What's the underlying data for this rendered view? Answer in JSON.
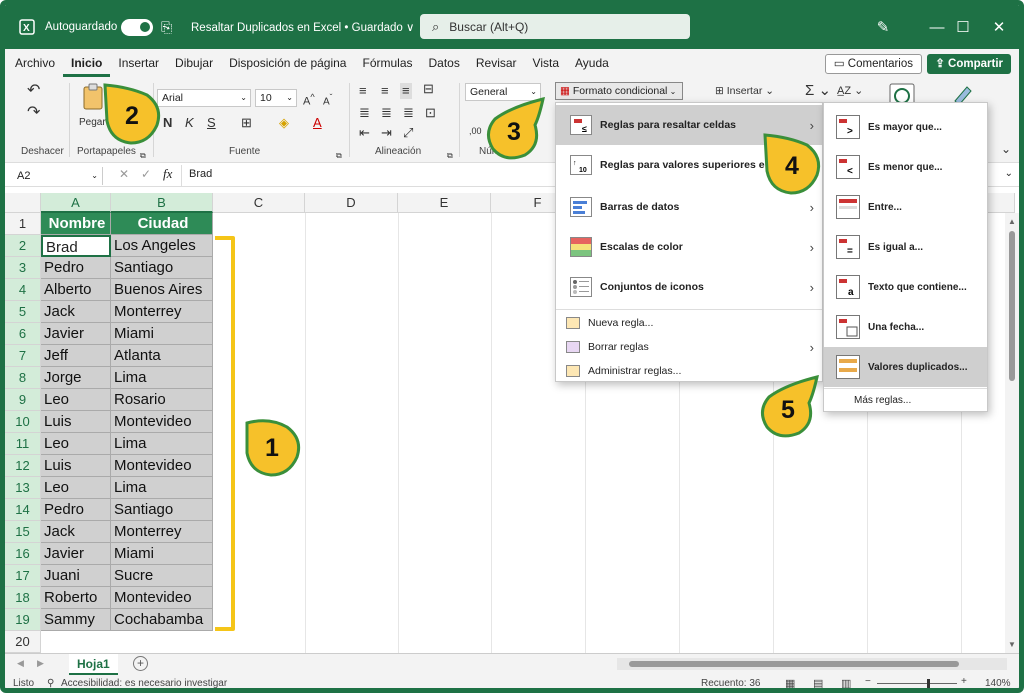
{
  "titlebar": {
    "autosave_label": "Autoguardado",
    "doc_title": "Resaltar Duplicados en Excel • Guardado ∨",
    "search_placeholder": "Buscar (Alt+Q)"
  },
  "menu": {
    "items": [
      "Archivo",
      "Inicio",
      "Insertar",
      "Dibujar",
      "Disposición de página",
      "Fórmulas",
      "Datos",
      "Revisar",
      "Vista",
      "Ayuda"
    ],
    "active": "Inicio",
    "comments_label": "Comentarios",
    "share_label": "Compartir"
  },
  "ribbon": {
    "undo_label": "Deshacer",
    "paste_label": "Pegar",
    "clipboard_label": "Portapapeles",
    "font_name": "Arial",
    "font_size": "10",
    "font_group_label": "Fuente",
    "bold": "N",
    "italic": "K",
    "underline": "S",
    "align_label": "Alineación",
    "number_format": "General",
    "number_label": "Núm",
    "cond_format_label": "Formato condicional",
    "insert_label": "Insertar"
  },
  "formula_bar": {
    "cell_ref": "A2",
    "fx": "fx",
    "value": "Brad"
  },
  "columns": [
    "A",
    "B",
    "C",
    "D",
    "E",
    "F",
    "K"
  ],
  "headers": [
    "Nombre",
    "Ciudad"
  ],
  "rows": [
    [
      "Brad",
      "Los Angeles"
    ],
    [
      "Pedro",
      "Santiago"
    ],
    [
      "Alberto",
      "Buenos Aires"
    ],
    [
      "Jack",
      "Monterrey"
    ],
    [
      "Javier",
      "Miami"
    ],
    [
      "Jeff",
      "Atlanta"
    ],
    [
      "Jorge",
      "Lima"
    ],
    [
      "Leo",
      "Rosario"
    ],
    [
      "Luis",
      "Montevideo"
    ],
    [
      "Leo",
      "Lima"
    ],
    [
      "Luis",
      "Montevideo"
    ],
    [
      "Leo",
      "Lima"
    ],
    [
      "Pedro",
      "Santiago"
    ],
    [
      "Jack",
      "Monterrey"
    ],
    [
      "Javier",
      "Miami"
    ],
    [
      "Juani",
      "Sucre"
    ],
    [
      "Roberto",
      "Montevideo"
    ],
    [
      "Sammy",
      "Cochabamba"
    ]
  ],
  "row_numbers": [
    "1",
    "2",
    "3",
    "4",
    "5",
    "6",
    "7",
    "8",
    "9",
    "10",
    "11",
    "12",
    "13",
    "14",
    "15",
    "16",
    "17",
    "18",
    "19",
    "20"
  ],
  "cf_menu": {
    "items": [
      "Reglas para resaltar celdas",
      "Reglas para valores superiores e in",
      "Barras de datos",
      "Escalas de color",
      "Conjuntos de iconos"
    ],
    "small_items": [
      "Nueva regla...",
      "Borrar reglas",
      "Administrar reglas..."
    ]
  },
  "submenu": {
    "items": [
      "Es mayor que...",
      "Es menor que...",
      "Entre...",
      "Es igual a...",
      "Texto que contiene...",
      "Una fecha...",
      "Valores duplicados..."
    ],
    "more": "Más reglas..."
  },
  "badges": [
    "1",
    "2",
    "3",
    "4",
    "5"
  ],
  "sheet": {
    "tab": "Hoja1"
  },
  "status": {
    "mode": "Listo",
    "accessibility": "Accesibilidad: es necesario investigar",
    "count": "Recuento: 36",
    "zoom": "140%"
  },
  "colors": {
    "excel_green": "#1e7145",
    "header_green": "#2e8b57",
    "badge_yellow": "#f6c12a",
    "bracket_yellow": "#f5c518"
  }
}
